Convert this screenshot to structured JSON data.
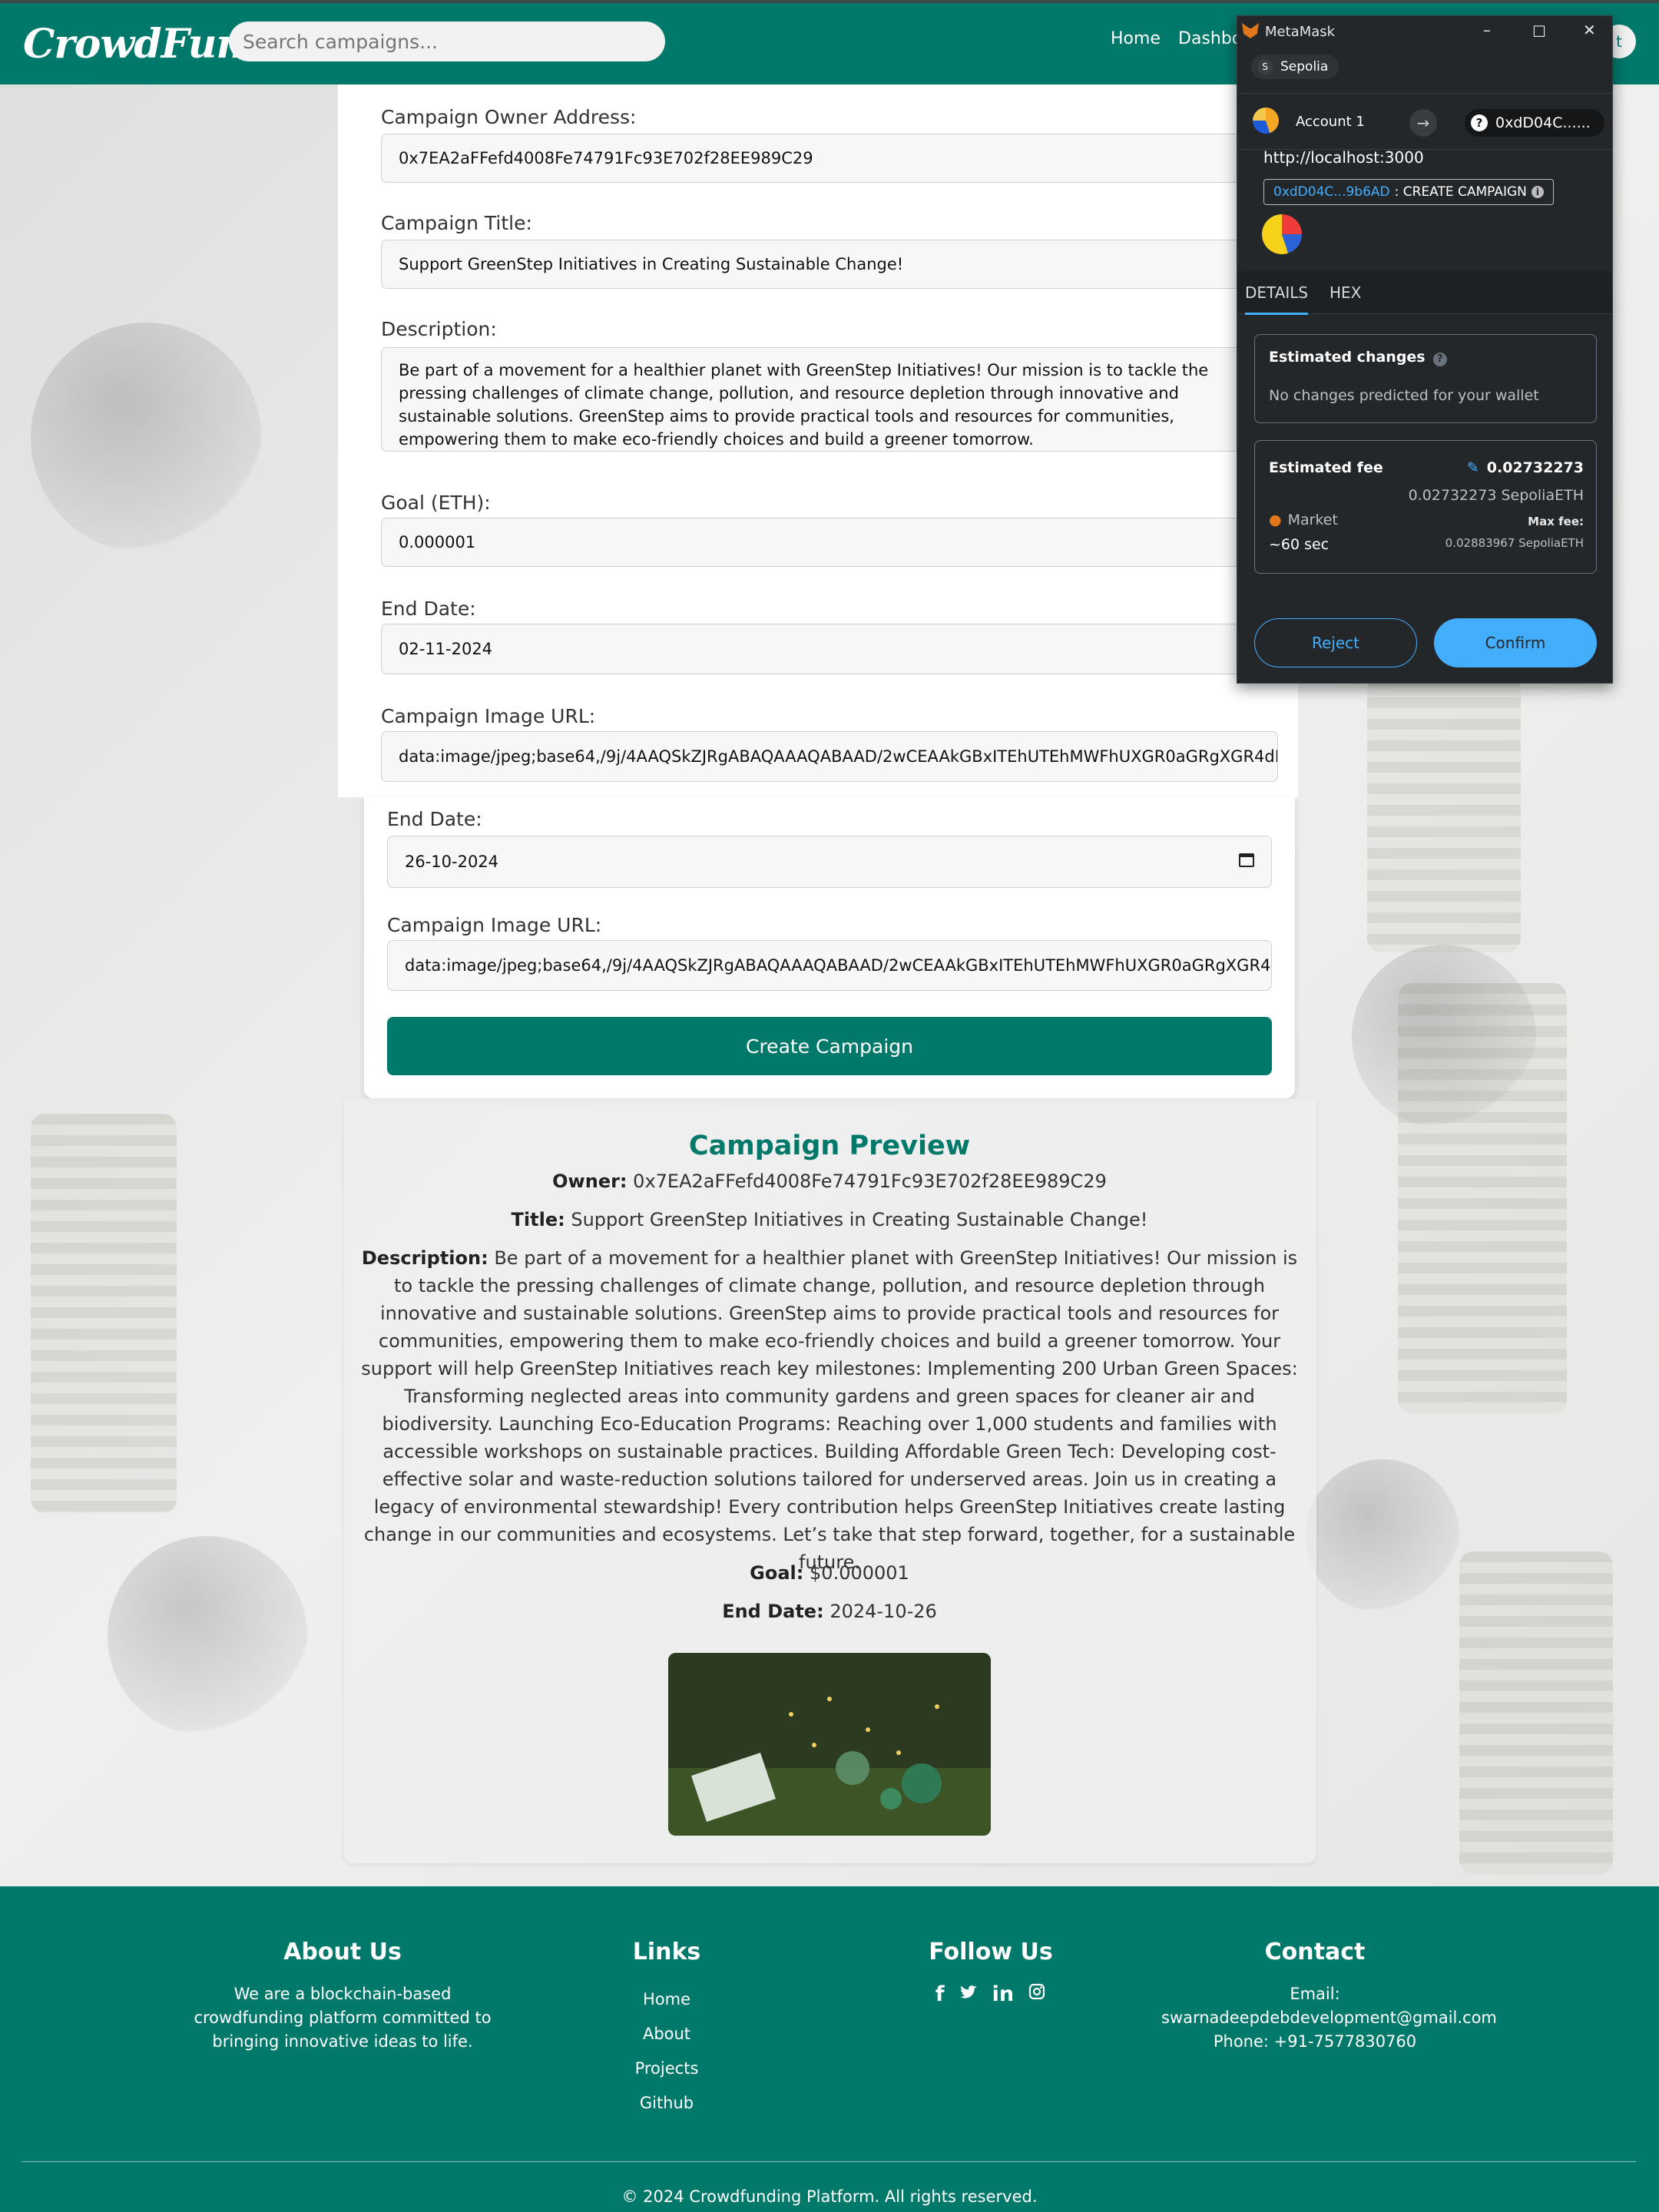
{
  "header": {
    "logo": "CrowdFund",
    "search_placeholder": "Search campaigns...",
    "nav_home": "Home",
    "nav_dashboard": "Dashbo",
    "nav_cut": "t"
  },
  "form": {
    "owner_label": "Campaign Owner Address:",
    "owner_value": "0x7EA2aFFefd4008Fe74791Fc93E702f28EE989C29",
    "title_label": "Campaign Title:",
    "title_value": "Support GreenStep Initiatives in Creating Sustainable Change!",
    "description_label": "Description:",
    "description_value": "Be part of a movement for a healthier planet with GreenStep Initiatives! Our mission is to tackle the pressing challenges of climate change, pollution, and resource depletion through innovative and sustainable solutions. GreenStep aims to provide practical tools and resources for communities, empowering them to make eco-friendly choices and build a greener tomorrow.",
    "goal_label": "Goal (ETH):",
    "goal_value": "0.000001",
    "end_date_label": "End Date:",
    "end_date_value_upper": "02-11-2024",
    "end_date_value_lower": "26-10-2024",
    "image_url_label": "Campaign Image URL:",
    "image_url_value": "data:image/jpeg;base64,/9j/4AAQSkZJRgABAQAAAQABAAD/2wCEAAkGBxITEhUTEhMWFhUXGR0aGRgXGR4dHxs",
    "submit_label": "Create Campaign"
  },
  "preview": {
    "heading": "Campaign Preview",
    "owner_label": "Owner:",
    "owner_value": "0x7EA2aFFefd4008Fe74791Fc93E702f28EE989C29",
    "title_label": "Title:",
    "title_value": "Support GreenStep Initiatives in Creating Sustainable Change!",
    "description_label": "Description:",
    "description_value": "Be part of a movement for a healthier planet with GreenStep Initiatives! Our mission is to tackle the pressing challenges of climate change, pollution, and resource depletion through innovative and sustainable solutions. GreenStep aims to provide practical tools and resources for communities, empowering them to make eco-friendly choices and build a greener tomorrow. Your support will help GreenStep Initiatives reach key milestones: Implementing 200 Urban Green Spaces: Transforming neglected areas into community gardens and green spaces for cleaner air and biodiversity. Launching Eco-Education Programs: Reaching over 1,000 students and families with accessible workshops on sustainable practices. Building Affordable Green Tech: Developing cost-effective solar and waste-reduction solutions tailored for underserved areas. Join us in creating a legacy of environmental stewardship! Every contribution helps GreenStep Initiatives create lasting change in our communities and ecosystems. Let’s take that step forward, together, for a sustainable future.",
    "goal_label": "Goal:",
    "goal_value": "$0.000001",
    "end_date_label": "End Date:",
    "end_date_value": "2024-10-26"
  },
  "footer": {
    "about_heading": "About Us",
    "about_text": "We are a blockchain-based crowdfunding platform committed to bringing innovative ideas to life.",
    "links_heading": "Links",
    "links": [
      "Home",
      "About",
      "Projects",
      "Github"
    ],
    "follow_heading": "Follow Us",
    "social_icons": [
      "facebook-icon",
      "twitter-icon",
      "linkedin-icon",
      "instagram-icon"
    ],
    "contact_heading": "Contact",
    "contact_email_label": "Email:",
    "contact_email": "swarnadeepdebdevelopment@gmail.com",
    "contact_phone": "Phone: +91-7577830760",
    "copyright": "© 2024 Crowdfunding Platform. All rights reserved."
  },
  "metamask": {
    "window_title": "MetaMask",
    "network_initial": "S",
    "network": "Sepolia",
    "account_name": "Account 1",
    "to_address": "0xdD04C......",
    "origin": "http://localhost:3000",
    "method_address": "0xdD04C...9b6AD",
    "method_name": ": CREATE CAMPAIGN",
    "tab_details": "DETAILS",
    "tab_hex": "HEX",
    "estimated_changes_title": "Estimated changes",
    "estimated_changes_text": "No changes predicted for your wallet",
    "estimated_fee_title": "Estimated fee",
    "fee_primary": "0.02732273",
    "fee_secondary": "0.02732273 SepoliaETH",
    "fee_speed": "Market",
    "fee_time": "~60 sec",
    "max_fee_label": "Max fee:",
    "max_fee_value": "0.02883967 SepoliaETH",
    "reject_label": "Reject",
    "confirm_label": "Confirm"
  },
  "colors": {
    "brand": "#00796b",
    "metamask_bg": "#24272a",
    "metamask_accent": "#43aefc",
    "metamask_confirm": "#43aefc"
  }
}
